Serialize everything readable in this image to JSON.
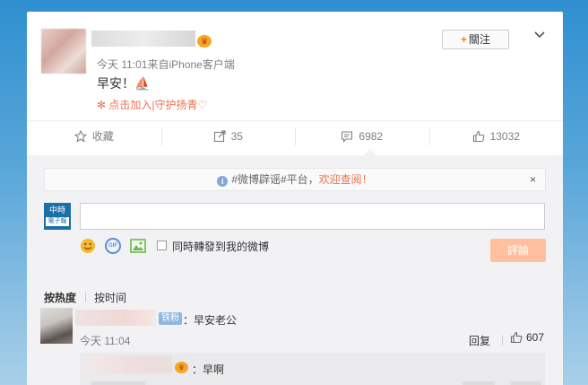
{
  "post": {
    "meta": "今天 11:01来自iPhone客户端",
    "text": "早安！⛵",
    "link": "✻ 点击加入|守护扬青♡",
    "follow_label": "關注",
    "follow_plus": "+"
  },
  "actions": {
    "favorite": "收藏",
    "repost": "35",
    "comment": "6982",
    "like": "13032"
  },
  "comment_box": {
    "notice_prefix": "#微博辟谣#平台，",
    "notice_highlight": "欢迎查阅！",
    "notice_close": "×",
    "avatar_top": "中時",
    "avatar_bottom": "電子報",
    "gif_label": "GIF",
    "repost_checkbox_label": "同時轉發到我的微博",
    "submit_label": "評論"
  },
  "sort": {
    "hot": "按热度",
    "separator": "|",
    "time": "按时间"
  },
  "comments": [
    {
      "tag": "铁粉",
      "text": "：早安老公",
      "time": "今天 11:04",
      "reply_label": "回复",
      "separator": "|",
      "likes": "607"
    }
  ],
  "replies": [
    {
      "text": "：早啊"
    }
  ],
  "colors": {
    "accent": "#ff8200",
    "link": "#eb7350",
    "submit_disabled": "#ffc09f"
  }
}
